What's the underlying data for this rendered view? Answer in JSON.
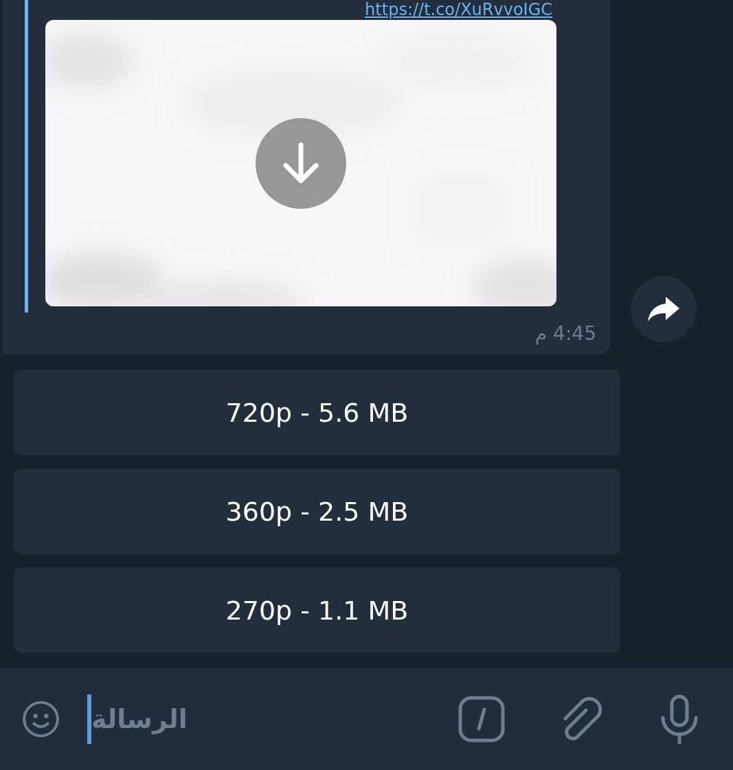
{
  "message": {
    "link": "https://t.co/XuRvvoIGC",
    "time": "4:45 م"
  },
  "keyboard_buttons": [
    {
      "label": "720p - 5.6 MB"
    },
    {
      "label": "360p - 2.5 MB"
    },
    {
      "label": "270p - 1.1 MB"
    }
  ],
  "composer": {
    "placeholder": "الرسالة"
  }
}
